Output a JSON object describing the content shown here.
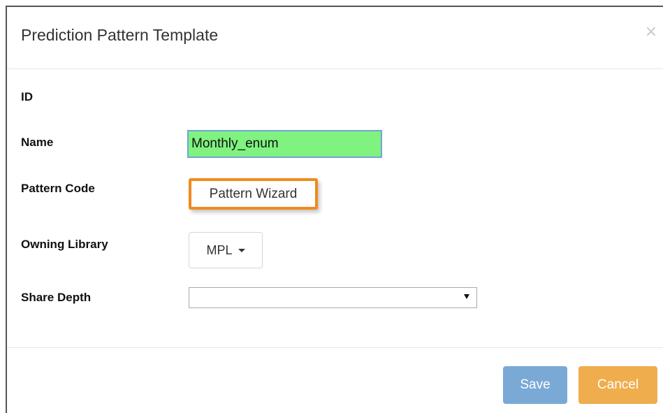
{
  "dialog": {
    "title": "Prediction Pattern Template",
    "close_glyph": "×"
  },
  "form": {
    "id_label": "ID",
    "name_label": "Name",
    "name_value": "Monthly_enum",
    "pattern_code_label": "Pattern Code",
    "pattern_wizard_button": "Pattern Wizard",
    "owning_library_label": "Owning Library",
    "owning_library_value": "MPL",
    "share_depth_label": "Share Depth",
    "share_depth_value": ""
  },
  "footer": {
    "save_label": "Save",
    "cancel_label": "Cancel"
  },
  "colors": {
    "name_field_highlight": "#7ff280",
    "wizard_outline": "#f08a1e",
    "save_button": "#7aa9d6",
    "cancel_button": "#f0ad4e"
  },
  "icons": {
    "close": "close-icon",
    "dropdown": "caret-down-icon"
  }
}
